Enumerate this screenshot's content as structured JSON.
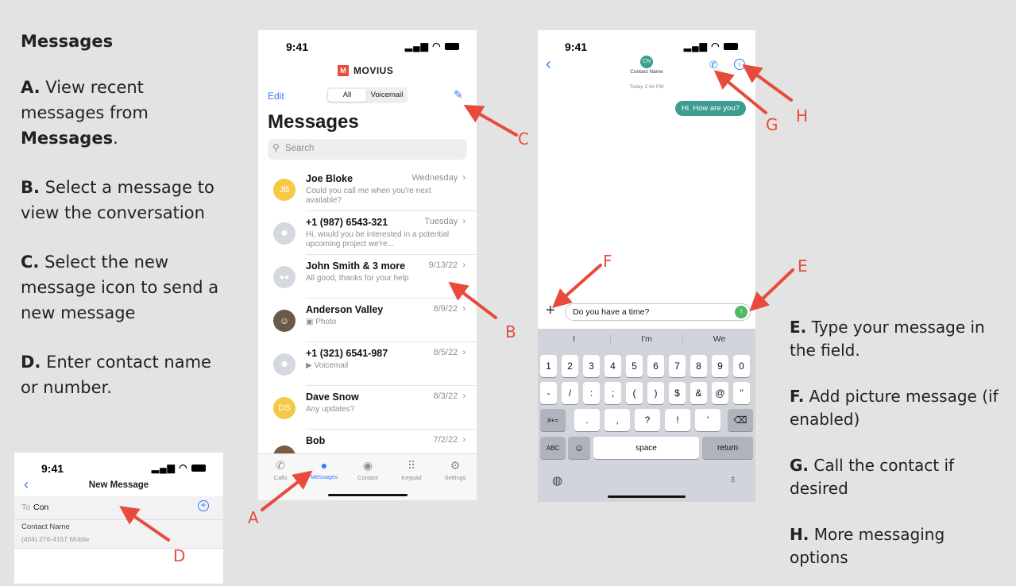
{
  "instructions": {
    "title": "Messages",
    "a": {
      "letter": "A.",
      "text_pre": " View recent messages from ",
      "bold": "Messages",
      "text_post": "."
    },
    "b": {
      "letter": "B.",
      "text": " Select a message to view the conversation"
    },
    "c": {
      "letter": "C.",
      "text": " Select the new message icon to send a new message"
    },
    "d": {
      "letter": "D.",
      "text": " Enter contact name or number."
    },
    "e": {
      "letter": "E.",
      "text": " Type your message in the field."
    },
    "f": {
      "letter": "F.",
      "text": " Add picture message (if enabled)"
    },
    "g": {
      "letter": "G.",
      "text": " Call the contact if desired"
    },
    "h": {
      "letter": "H.",
      "text": " More messaging options"
    }
  },
  "callouts": {
    "a": "A",
    "b": "B",
    "c": "C",
    "d": "D",
    "e": "E",
    "f": "F",
    "g": "G",
    "h": "H"
  },
  "new_message_screen": {
    "time": "9:41",
    "title": "New Message",
    "to_label": "To",
    "to_value": "Con",
    "suggestion_name": "Contact Name",
    "suggestion_detail": "(404) 276-4157 Mobile"
  },
  "inbox_screen": {
    "time": "9:41",
    "brand": "MOVIUS",
    "edit_label": "Edit",
    "segment_all": "All",
    "segment_voicemail": "Voicemail",
    "title": "Messages",
    "search_placeholder": "Search",
    "threads": [
      {
        "initials": "JB",
        "name": "Joe Bloke",
        "date": "Wednesday",
        "preview": "Could you call me when you're next available?",
        "unread": true
      },
      {
        "initials": "",
        "name": "+1 (987) 6543-321",
        "date": "Tuesday",
        "preview": "Hi, would you be interested in a potential upcoming project we're...",
        "unread": false
      },
      {
        "initials": "",
        "name": "John Smith & 3 more",
        "date": "9/13/22",
        "preview": "All good, thanks for your help",
        "unread": false
      },
      {
        "initials": "",
        "name": "Anderson Valley",
        "date": "8/9/22",
        "preview": "Photo",
        "unread": false
      },
      {
        "initials": "",
        "name": "+1 (321) 6541-987",
        "date": "8/5/22",
        "preview": "Voicemail",
        "unread": false
      },
      {
        "initials": "DS",
        "name": "Dave Snow",
        "date": "8/3/22",
        "preview": "Any updates?",
        "unread": false
      },
      {
        "initials": "",
        "name": "Bob",
        "date": "7/2/22",
        "preview": "",
        "unread": false
      }
    ],
    "tabs": [
      "Calls",
      "Messages",
      "Contact",
      "Keypad",
      "Settings"
    ]
  },
  "conversation_screen": {
    "time": "9:41",
    "contact_initials": "CN",
    "contact_name": "Contact Name",
    "timestamp": "Today 2:44 PM",
    "bubble": "Hi. How are you?",
    "composer_value": "Do you have a time?",
    "suggestions": [
      "I",
      "I'm",
      "We"
    ],
    "row_numbers": [
      "1",
      "2",
      "3",
      "4",
      "5",
      "6",
      "7",
      "8",
      "9",
      "0"
    ],
    "row_symbols": [
      "-",
      "/",
      ":",
      ";",
      "(",
      ")",
      "$",
      "&",
      "@",
      "\""
    ],
    "row_punct": [
      ".",
      ",",
      "?",
      "!",
      "'"
    ],
    "key_symbols_toggle": "#+=",
    "key_abc": "ABC",
    "key_space": "space",
    "key_return": "return"
  },
  "colors": {
    "accent": "#2d7ff9",
    "callout": "#e84b3c",
    "bubble": "#3a9d8f",
    "send": "#4cbb63"
  }
}
